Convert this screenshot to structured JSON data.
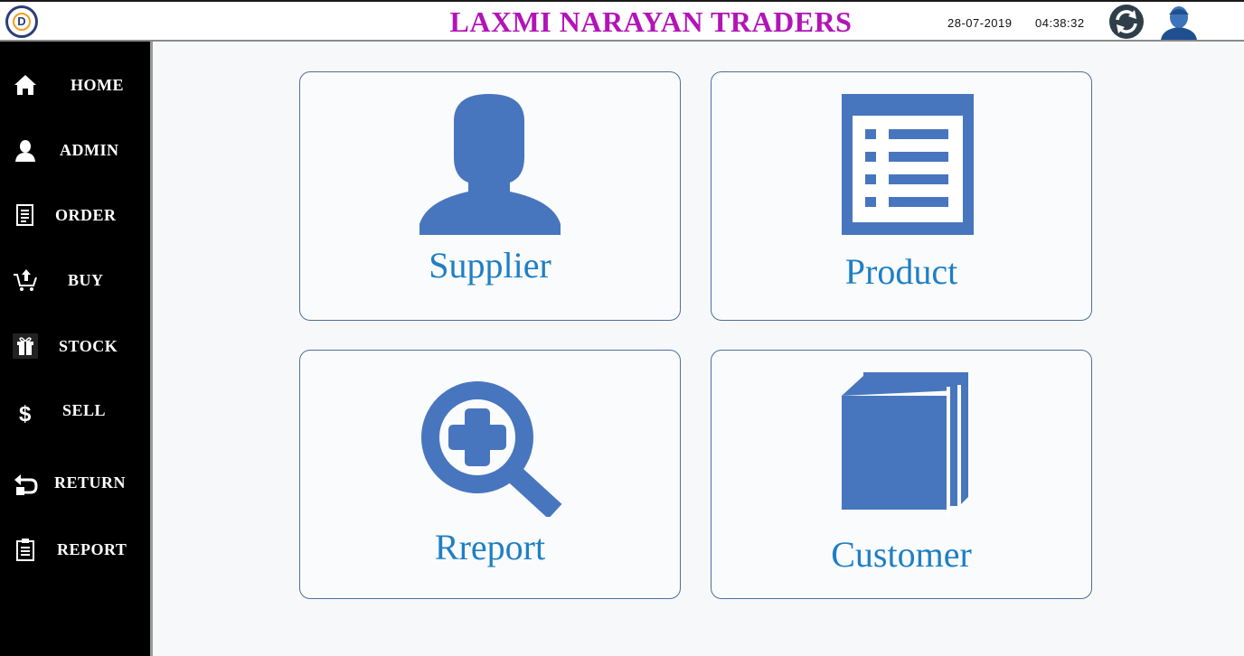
{
  "header": {
    "logo_letter": "D",
    "title": "LAXMI NARAYAN TRADERS",
    "date": "28-07-2019",
    "time": "04:38:32",
    "refresh_icon": "refresh-icon",
    "user_icon": "user-avatar-icon"
  },
  "sidebar": {
    "items": [
      {
        "label": "HOME",
        "icon": "home-icon"
      },
      {
        "label": "ADMIN",
        "icon": "admin-user-icon"
      },
      {
        "label": "ORDER",
        "icon": "order-document-icon"
      },
      {
        "label": "BUY",
        "icon": "cart-upload-icon"
      },
      {
        "label": "STOCK",
        "icon": "stock-box-icon"
      },
      {
        "label": "SELL",
        "icon": "dollar-icon"
      },
      {
        "label": "RETURN",
        "icon": "return-icon"
      },
      {
        "label": "REPORT",
        "icon": "clipboard-icon"
      }
    ]
  },
  "cards": [
    {
      "label": "Supplier",
      "icon": "person-silhouette-icon"
    },
    {
      "label": "Product",
      "icon": "list-document-icon"
    },
    {
      "label": "Rreport",
      "icon": "magnifier-plus-icon"
    },
    {
      "label": "Customer",
      "icon": "book-icon"
    }
  ],
  "colors": {
    "title": "#b214b8",
    "card_icon": "#4876be",
    "card_label": "#1e7fc4",
    "sidebar_bg": "#000000",
    "card_border": "#4d6f9c"
  }
}
